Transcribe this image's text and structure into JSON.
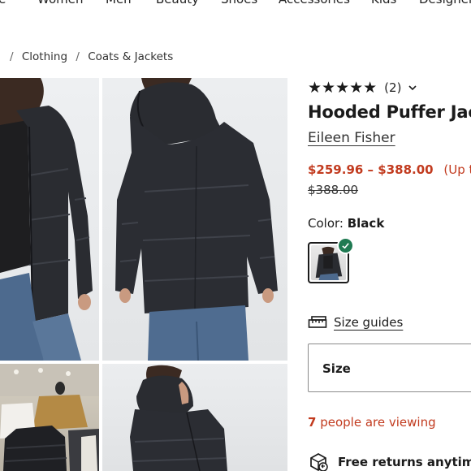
{
  "nav": {
    "items": [
      "le",
      "Women",
      "Men",
      "Beauty",
      "Shoes",
      "Accessories",
      "Kids",
      "Designer"
    ]
  },
  "breadcrumb": {
    "items": [
      "Clothing",
      "Coats & Jackets"
    ]
  },
  "product": {
    "rating_stars": "★★★★★",
    "rating_count": "(2)",
    "title": "Hooded Puffer Jack",
    "brand": "Eileen Fisher",
    "price_sale": "$259.96 – $388.00",
    "price_pct": "(Up to",
    "price_original": "$388.00",
    "color_label": "Color:",
    "color_value": "Black",
    "size_guides": "Size guides",
    "size_select": "Size",
    "viewing_count": "7",
    "viewing_text": "people are viewing",
    "returns": "Free returns anytime"
  },
  "colors": {
    "sale_red": "#c23b1f",
    "check_green": "#1f7a52",
    "jacket": "#2a2c31"
  },
  "icons": [
    "chevron-down-icon",
    "checkmark-icon",
    "size-guide-ruler-icon",
    "returns-box-icon",
    "star-icon"
  ]
}
